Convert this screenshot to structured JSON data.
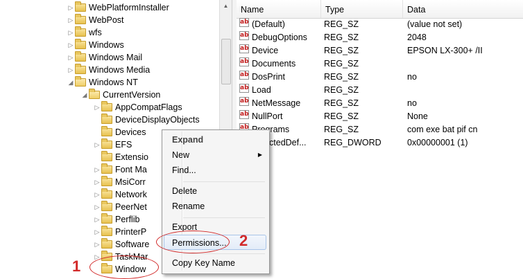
{
  "tree": {
    "items": [
      {
        "label": "WebPlatformInstaller",
        "level": 0,
        "expanded": false,
        "has_children": true
      },
      {
        "label": "WebPost",
        "level": 0,
        "expanded": false,
        "has_children": true
      },
      {
        "label": "wfs",
        "level": 0,
        "expanded": false,
        "has_children": true
      },
      {
        "label": "Windows",
        "level": 0,
        "expanded": false,
        "has_children": true
      },
      {
        "label": "Windows Mail",
        "level": 0,
        "expanded": false,
        "has_children": true
      },
      {
        "label": "Windows Media",
        "level": 0,
        "expanded": false,
        "has_children": true
      },
      {
        "label": "Windows NT",
        "level": 0,
        "expanded": true,
        "has_children": true
      },
      {
        "label": "CurrentVersion",
        "level": 1,
        "expanded": true,
        "has_children": true
      },
      {
        "label": "AppCompatFlags",
        "level": 2,
        "expanded": false,
        "has_children": true
      },
      {
        "label": "DeviceDisplayObjects",
        "level": 2,
        "expanded": false,
        "has_children": false
      },
      {
        "label": "Devices",
        "level": 2,
        "expanded": false,
        "has_children": false
      },
      {
        "label": "EFS",
        "level": 2,
        "expanded": false,
        "has_children": true
      },
      {
        "label": "Extensio",
        "level": 2,
        "expanded": false,
        "has_children": false
      },
      {
        "label": "Font Ma",
        "level": 2,
        "expanded": false,
        "has_children": true
      },
      {
        "label": "MsiCorr",
        "level": 2,
        "expanded": false,
        "has_children": true
      },
      {
        "label": "Network",
        "level": 2,
        "expanded": false,
        "has_children": true
      },
      {
        "label": "PeerNet",
        "level": 2,
        "expanded": false,
        "has_children": true
      },
      {
        "label": "Perflib",
        "level": 2,
        "expanded": false,
        "has_children": true
      },
      {
        "label": "PrinterP",
        "level": 2,
        "expanded": false,
        "has_children": true
      },
      {
        "label": "Software",
        "level": 2,
        "expanded": false,
        "has_children": true
      },
      {
        "label": "TaskMar",
        "level": 2,
        "expanded": false,
        "has_children": true
      },
      {
        "label": "Window",
        "level": 2,
        "expanded": false,
        "has_children": false
      }
    ]
  },
  "values_list": {
    "columns": {
      "name": "Name",
      "type": "Type",
      "data": "Data"
    },
    "rows": [
      {
        "name": "(Default)",
        "type": "REG_SZ",
        "data": "(value not set)",
        "icon": "string-value-icon"
      },
      {
        "name": "DebugOptions",
        "type": "REG_SZ",
        "data": "2048",
        "icon": "string-value-icon"
      },
      {
        "name": "Device",
        "type": "REG_SZ",
        "data": "EPSON LX-300+ /II",
        "icon": "string-value-icon"
      },
      {
        "name": "Documents",
        "type": "REG_SZ",
        "data": "",
        "icon": "string-value-icon"
      },
      {
        "name": "DosPrint",
        "type": "REG_SZ",
        "data": "no",
        "icon": "string-value-icon"
      },
      {
        "name": "Load",
        "type": "REG_SZ",
        "data": "",
        "icon": "string-value-icon"
      },
      {
        "name": "NetMessage",
        "type": "REG_SZ",
        "data": "no",
        "icon": "string-value-icon"
      },
      {
        "name": "NullPort",
        "type": "REG_SZ",
        "data": "None",
        "icon": "string-value-icon"
      },
      {
        "name": "Programs",
        "type": "REG_SZ",
        "data": "com exe bat pif cn",
        "icon": "string-value-icon"
      },
      {
        "name": "SelectedDef...",
        "type": "REG_DWORD",
        "data": "0x00000001 (1)",
        "icon": "dword-value-icon"
      }
    ]
  },
  "context_menu": {
    "expand": "Expand",
    "new": "New",
    "find": "Find...",
    "delete": "Delete",
    "rename": "Rename",
    "export": "Export",
    "permissions": "Permissions...",
    "copy_key_name": "Copy Key Name"
  },
  "annotations": {
    "step1": "1",
    "step2": "2",
    "color": "#d22a2a"
  },
  "icon_glyph": "ab"
}
